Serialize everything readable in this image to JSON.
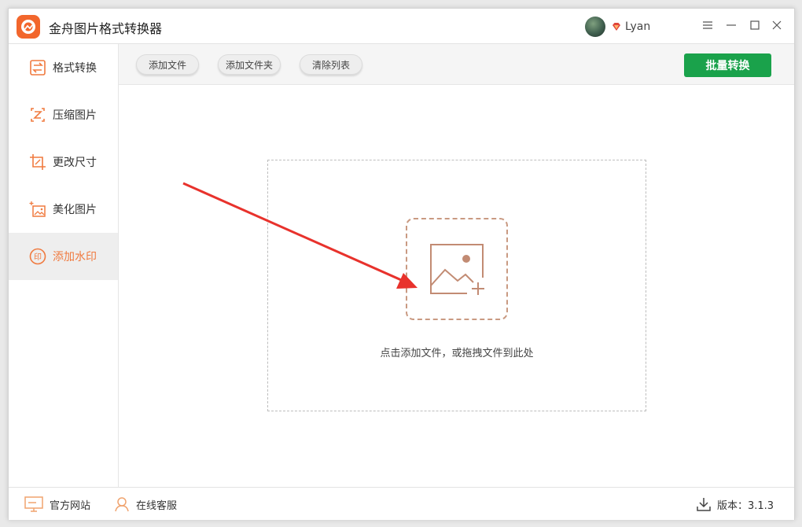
{
  "app": {
    "title": "金舟图片格式转换器"
  },
  "user": {
    "name": "Lyan"
  },
  "sidebar": {
    "items": [
      {
        "label": "格式转换",
        "icon": "format-convert-icon",
        "active": false
      },
      {
        "label": "压缩图片",
        "icon": "compress-icon",
        "active": false
      },
      {
        "label": "更改尺寸",
        "icon": "resize-icon",
        "active": false
      },
      {
        "label": "美化图片",
        "icon": "beautify-icon",
        "active": false
      },
      {
        "label": "添加水印",
        "icon": "watermark-icon",
        "active": true
      }
    ]
  },
  "toolbar": {
    "add_file": "添加文件",
    "add_folder": "添加文件夹",
    "clear_list": "清除列表",
    "batch_convert": "批量转换"
  },
  "main": {
    "drop_hint": "点击添加文件，或拖拽文件到此处"
  },
  "footer": {
    "website": "官方网站",
    "support": "在线客服",
    "version_label": "版本：3.1.3"
  },
  "colors": {
    "accent": "#f07a3f",
    "primary_button": "#1aa24b",
    "arrow": "#e8322c"
  }
}
